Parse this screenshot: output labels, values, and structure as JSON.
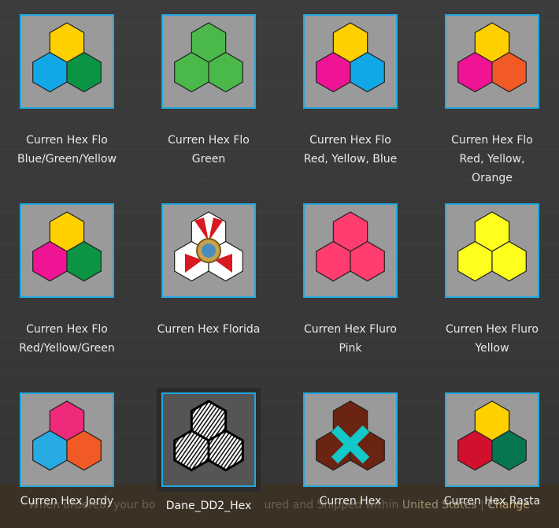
{
  "items": [
    {
      "line1": "Curren Hex Flo",
      "line2": "Blue/Green/Yellow",
      "line3": "",
      "colors": {
        "top": "#ffd000",
        "left": "#12a8e8",
        "right": "#0b9444"
      }
    },
    {
      "line1": "Curren Hex Flo",
      "line2": "Green",
      "line3": "",
      "colors": {
        "top": "#4bb84a",
        "left": "#4bb84a",
        "right": "#4bb84a"
      }
    },
    {
      "line1": "Curren Hex Flo",
      "line2": "Red, Yellow, Blue",
      "line3": "",
      "colors": {
        "top": "#ffd000",
        "left": "#ee1493",
        "right": "#12a8e8"
      }
    },
    {
      "line1": "Curren Hex Flo",
      "line2": "Red, Yellow,",
      "line3": "Orange",
      "colors": {
        "top": "#ffd000",
        "left": "#ee1493",
        "right": "#f15a24"
      }
    },
    {
      "line1": "Curren Hex Flo",
      "line2": "Red/Yellow/Green",
      "line3": "",
      "colors": {
        "top": "#ffd000",
        "left": "#ee1493",
        "right": "#0b9444"
      }
    },
    {
      "line1": "Curren Hex Florida",
      "line2": "",
      "line3": "",
      "colors": {
        "top": "#ffffff",
        "left": "#ffffff",
        "right": "#ffffff"
      },
      "flag": true
    },
    {
      "line1": "Curren Hex Fluro",
      "line2": "Pink",
      "line3": "",
      "colors": {
        "top": "#ff3d6e",
        "left": "#ff3d6e",
        "right": "#ff3d6e"
      }
    },
    {
      "line1": "Curren Hex Fluro",
      "line2": "Yellow",
      "line3": "",
      "colors": {
        "top": "#ffff1e",
        "left": "#ffff1e",
        "right": "#ffff1e"
      }
    },
    {
      "line1": "Curren Hex Jordy",
      "line2": "",
      "line3": "",
      "colors": {
        "top": "#ee2a7b",
        "left": "#27aae1",
        "right": "#f15a24"
      }
    },
    {
      "line1": "Dane_DD2_Hex",
      "line2": "",
      "line3": "",
      "colors": {
        "top": "#ffffff",
        "left": "#ffffff",
        "right": "#ffffff"
      },
      "pattern": true,
      "selected": true
    },
    {
      "line1": "Curren Hex",
      "line2": "",
      "line3": "",
      "colors": {
        "top": "#6b2412",
        "left": "#6b2412",
        "right": "#6b2412"
      },
      "cross": "#12c8c8"
    },
    {
      "line1": "Curren Hex Rasta",
      "line2": "",
      "line3": "",
      "colors": {
        "top": "#ffd000",
        "left": "#d0102c",
        "right": "#067650"
      }
    }
  ],
  "footer": {
    "prefix": "When ordered, your bo",
    "middle": "ured and Shipped within ",
    "country": "United States",
    "sep": " | ",
    "change": "Change"
  }
}
